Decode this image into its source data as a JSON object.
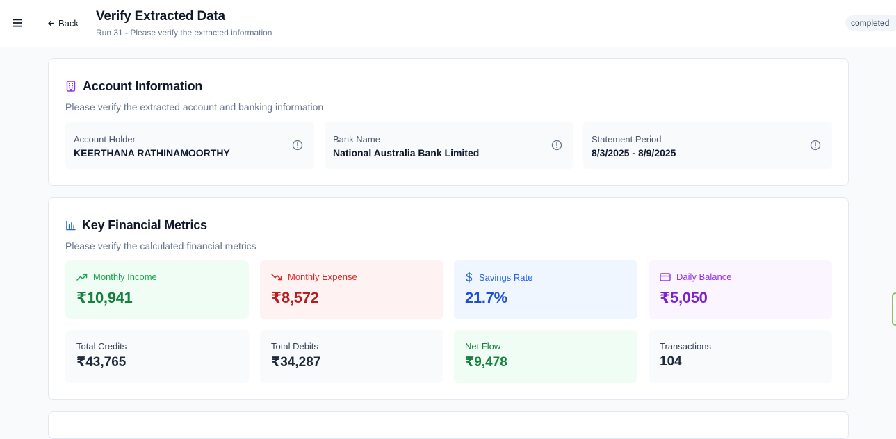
{
  "header": {
    "back_label": "Back",
    "title": "Verify Extracted Data",
    "subtitle": "Run 31 - Please verify the extracted information",
    "status": "completed"
  },
  "account": {
    "title": "Account Information",
    "description": "Please verify the extracted account and banking information",
    "fields": [
      {
        "label": "Account Holder",
        "value": "KEERTHANA RATHINAMOORTHY"
      },
      {
        "label": "Bank Name",
        "value": "National Australia Bank Limited"
      },
      {
        "label": "Statement Period",
        "value": "8/3/2025 - 8/9/2025"
      }
    ]
  },
  "metrics": {
    "title": "Key Financial Metrics",
    "description": "Please verify the calculated financial metrics",
    "cards": [
      {
        "label": "Monthly Income",
        "value": "₹10,941",
        "icon": "trending-up-icon"
      },
      {
        "label": "Monthly Expense",
        "value": "₹8,572",
        "icon": "trending-down-icon"
      },
      {
        "label": "Savings Rate",
        "value": "21.7%",
        "icon": "dollar-icon"
      },
      {
        "label": "Daily Balance",
        "value": "₹5,050",
        "icon": "credit-card-icon"
      }
    ],
    "stats": [
      {
        "label": "Total Credits",
        "value": "₹43,765"
      },
      {
        "label": "Total Debits",
        "value": "₹34,287"
      },
      {
        "label": "Net Flow",
        "value": "₹9,478"
      },
      {
        "label": "Transactions",
        "value": "104"
      }
    ]
  },
  "colors": {
    "income_bg": "#f0fdf4",
    "income_text": "#15803d",
    "income_label": "#16a34a",
    "expense_bg": "#fef2f2",
    "expense_text": "#b91c1c",
    "expense_label": "#dc2626",
    "savings_bg": "#eff6ff",
    "savings_text": "#1d4ed8",
    "savings_label": "#2563eb",
    "balance_bg": "#faf5ff",
    "balance_text": "#7e22ce",
    "balance_label": "#9333ea",
    "netflow_bg": "#f0fdf4",
    "netflow_text": "#15803d"
  }
}
